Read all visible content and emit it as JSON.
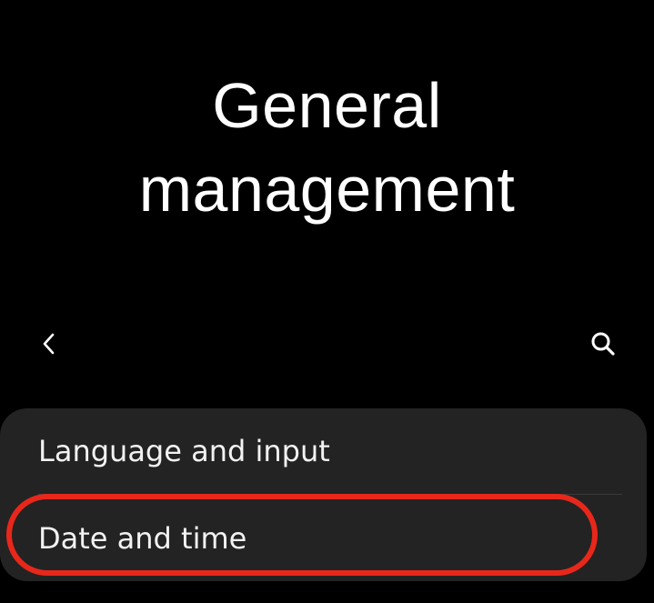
{
  "header": {
    "title_line1": "General",
    "title_line2": "management"
  },
  "toolbar": {
    "back_icon": "chevron-left-icon",
    "search_icon": "search-icon"
  },
  "menu": {
    "items": [
      {
        "label": "Language and input"
      },
      {
        "label": "Date and time",
        "highlighted": true
      }
    ]
  },
  "colors": {
    "background": "#000000",
    "card": "#232323",
    "text": "#ffffff",
    "highlight": "#e8271b"
  }
}
